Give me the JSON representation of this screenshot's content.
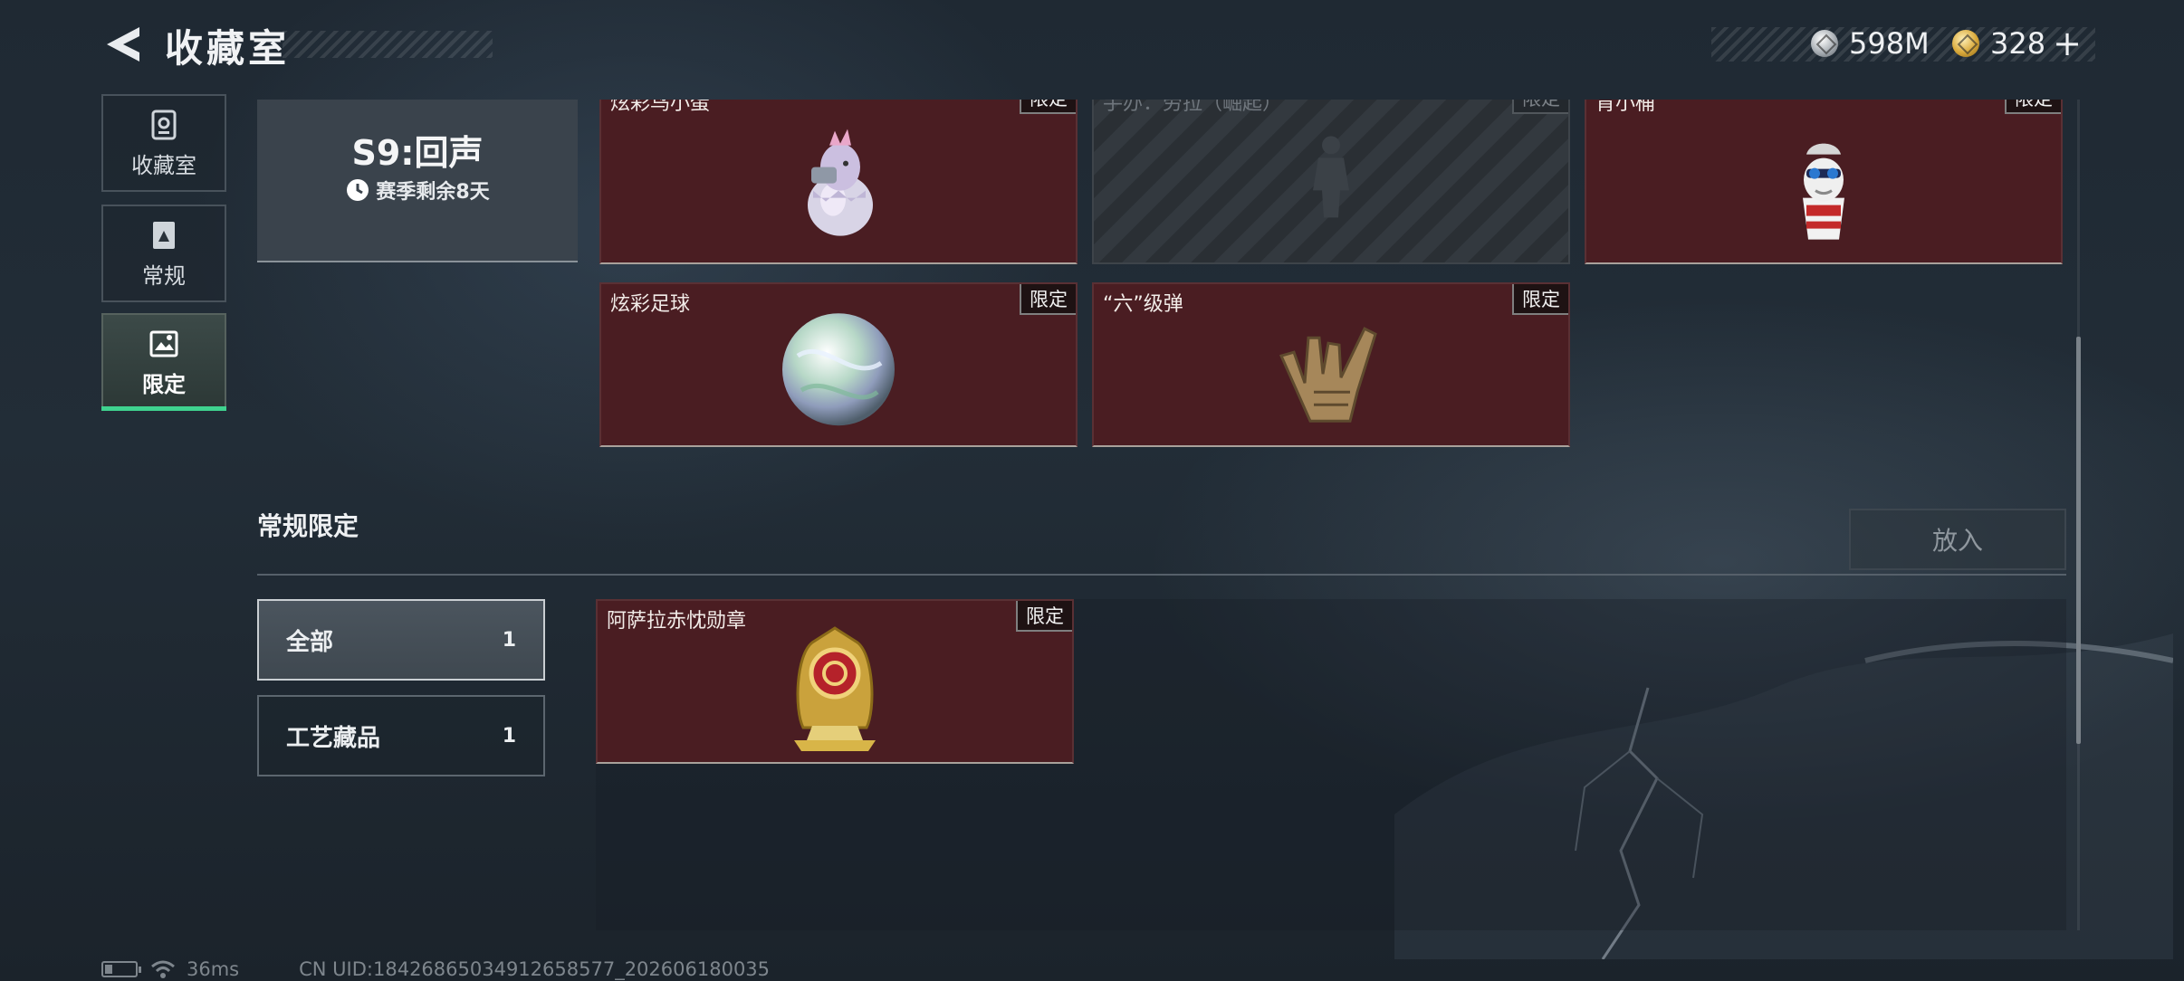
{
  "header": {
    "title": "收藏室",
    "currency_silver": "598M",
    "currency_gold": "328",
    "plus": "+"
  },
  "nav": [
    {
      "label": "收藏室",
      "icon": "collection-room-icon"
    },
    {
      "label": "常规",
      "icon": "regular-card-icon"
    },
    {
      "label": "限定",
      "icon": "limited-image-icon",
      "active": true
    }
  ],
  "season": {
    "name": "S9:回声",
    "remaining": "赛季剩余8天"
  },
  "top_items": [
    {
      "name": "炫彩鸟小蛋",
      "tag": "限定",
      "art": "dragon-egg-figure",
      "locked": false
    },
    {
      "name": "手办：劳拉（崛起）",
      "tag": "限定",
      "art": "locked-figure-silhouette",
      "locked": true
    },
    {
      "name": "肯小桶",
      "tag": "限定",
      "art": "bucket-mascot-figure",
      "locked": false
    },
    {
      "name": "炫彩足球",
      "tag": "限定",
      "art": "iridescent-football",
      "locked": false
    },
    {
      "name": "“六”级弹",
      "tag": "限定",
      "art": "golden-hand-gesture",
      "locked": false
    }
  ],
  "section": {
    "title": "常规限定",
    "put_button": "放入"
  },
  "filters": [
    {
      "label": "全部",
      "count": "1",
      "active": true
    },
    {
      "label": "工艺藏品",
      "count": "1",
      "active": false
    }
  ],
  "section_items": [
    {
      "name": "阿萨拉赤忱勋章",
      "tag": "限定",
      "art": "gold-medal-badge"
    }
  ],
  "status": {
    "latency": "36ms",
    "uid": "CN UID:18426865034912658577_202606180035"
  },
  "colors": {
    "accent_green": "#3fd38f",
    "card_red": "#4a1d22"
  }
}
